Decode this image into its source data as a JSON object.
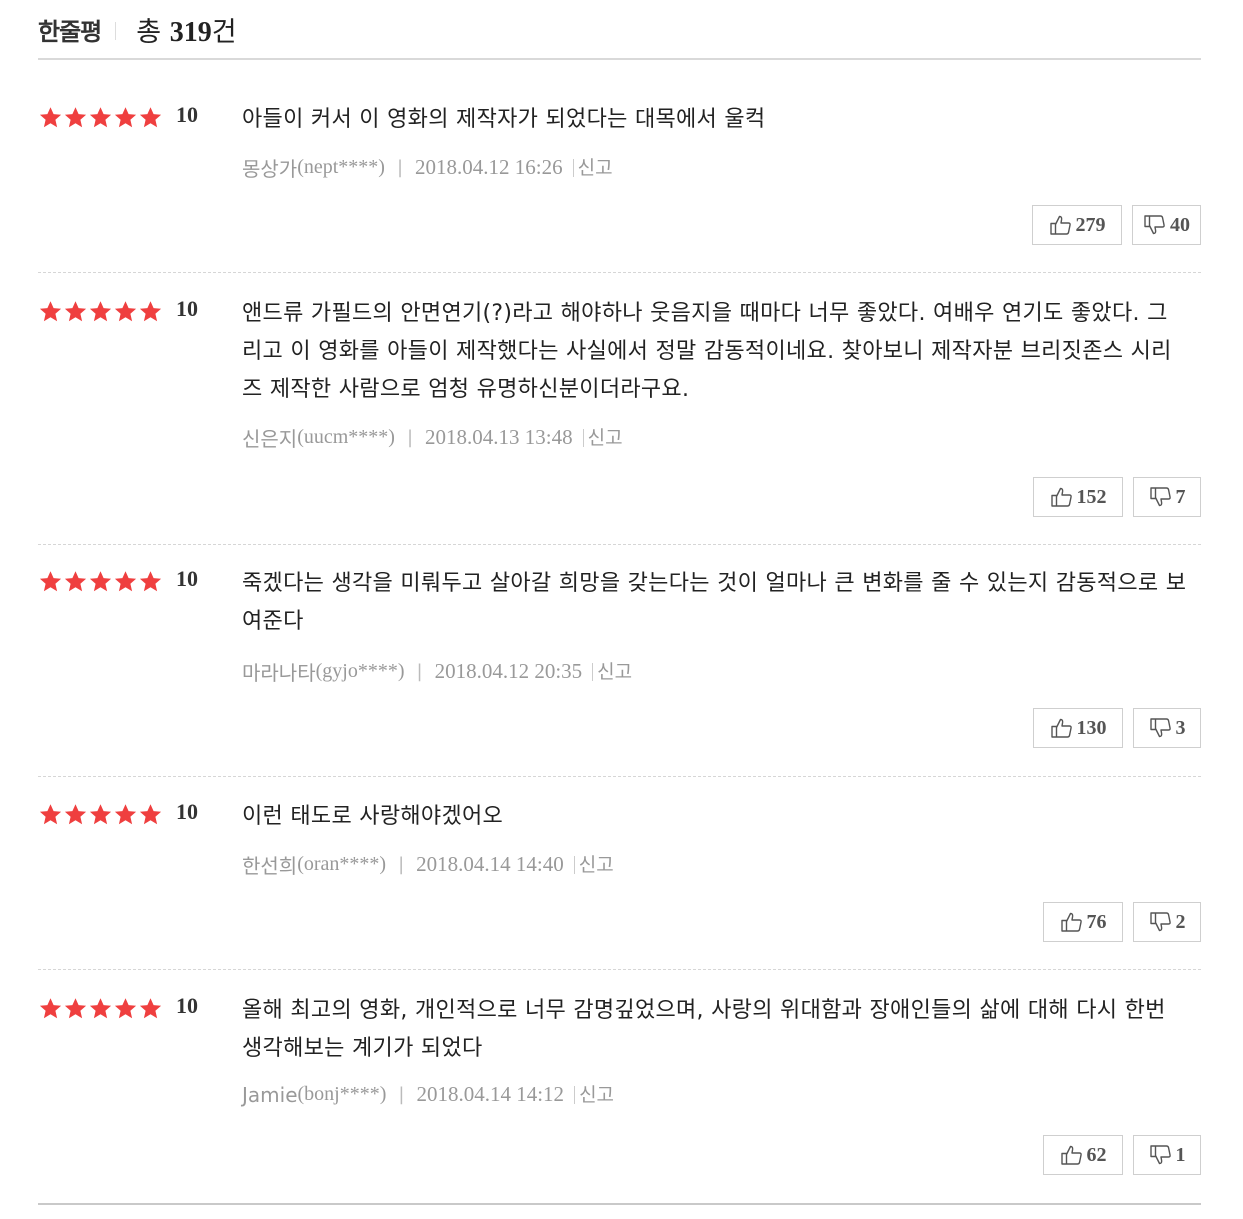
{
  "header": {
    "title": "한줄평",
    "count_prefix": "총 ",
    "count": "319",
    "count_suffix": "건"
  },
  "colors": {
    "star": "#ef3f3f",
    "meta": "#999999"
  },
  "reviews": [
    {
      "rating": "10",
      "text": "아들이 커서 이 영화의 제작자가 되었다는 대목에서 울컥",
      "nickname": "몽상가",
      "userid": "(nept****)",
      "separator": "|",
      "date": "2018.04.12 16:26",
      "report": "신고",
      "likes": "279",
      "dislikes": "40"
    },
    {
      "rating": "10",
      "text": "앤드류 가필드의 안면연기(?)라고 해야하나 웃음지을 때마다 너무 좋았다. 여배우 연기도 좋았다. 그리고 이 영화를 아들이 제작했다는 사실에서 정말 감동적이네요. 찾아보니 제작자분 브리짓존스 시리즈 제작한 사람으로 엄청 유명하신분이더라구요.",
      "nickname": "신은지",
      "userid": "(uucm****)",
      "separator": "|",
      "date": "2018.04.13 13:48",
      "report": "신고",
      "likes": "152",
      "dislikes": "7"
    },
    {
      "rating": "10",
      "text": "죽겠다는 생각을 미뤄두고 살아갈 희망을 갖는다는 것이 얼마나 큰 변화를 줄 수 있는지 감동적으로 보여준다",
      "nickname": "마라나타",
      "userid": "(gyjo****)",
      "separator": "|",
      "date": "2018.04.12 20:35",
      "report": "신고",
      "likes": "130",
      "dislikes": "3"
    },
    {
      "rating": "10",
      "text": "이런 태도로 사랑해야겠어오",
      "nickname": "한선희",
      "userid": "(oran****)",
      "separator": "|",
      "date": "2018.04.14 14:40",
      "report": "신고",
      "likes": "76",
      "dislikes": "2"
    },
    {
      "rating": "10",
      "text": "올해 최고의 영화, 개인적으로 너무 감명깊었으며, 사랑의 위대함과 장애인들의 삶에 대해 다시 한번 생각해보는 계기가 되었다",
      "nickname": "Jamie",
      "userid": "(bonj****)",
      "separator": "|",
      "date": "2018.04.14 14:12",
      "report": "신고",
      "likes": "62",
      "dislikes": "1"
    }
  ]
}
